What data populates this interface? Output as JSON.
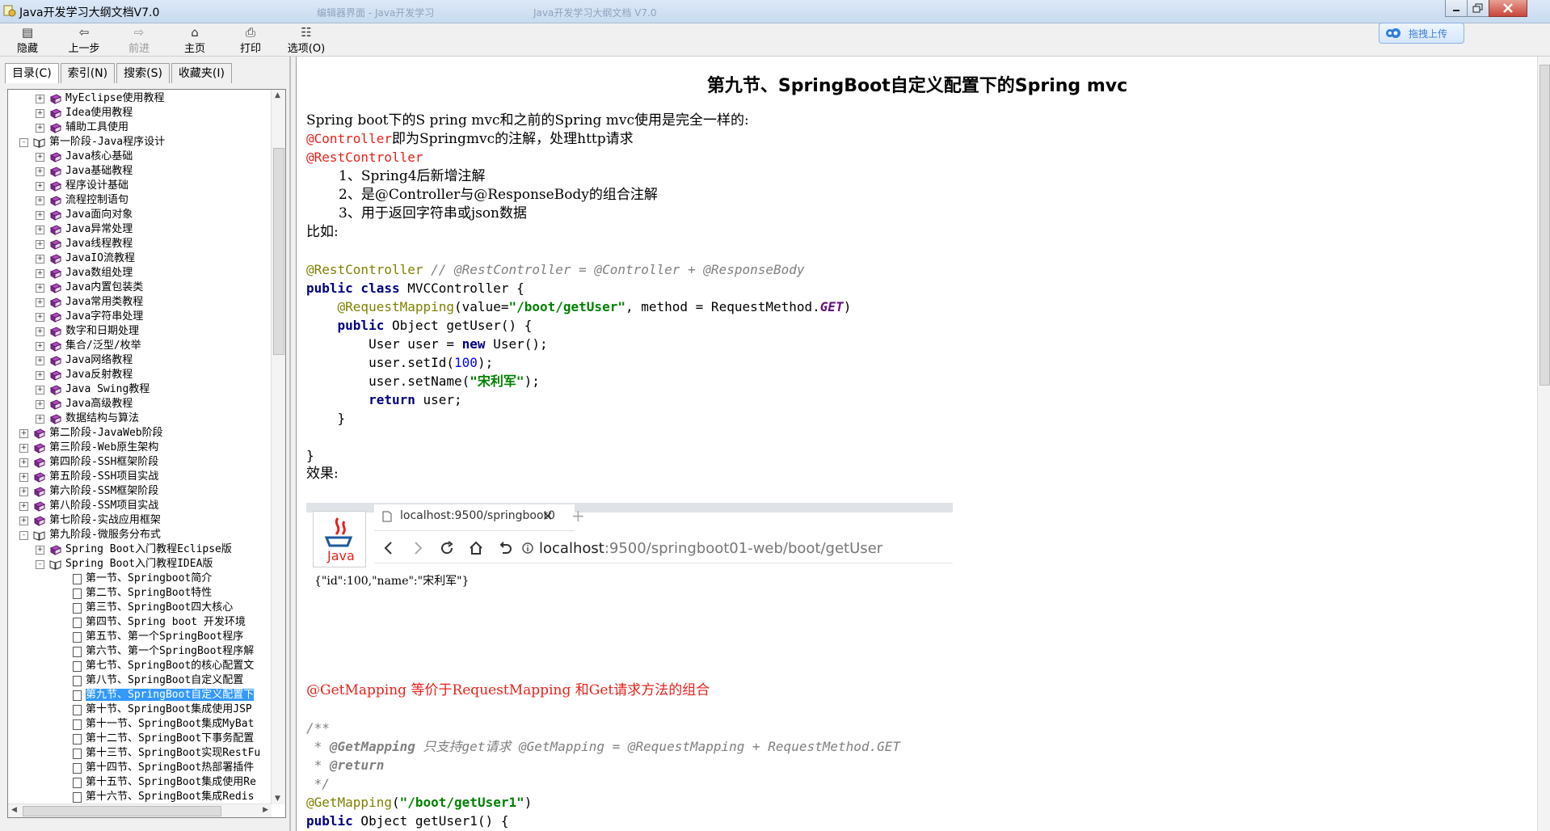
{
  "window": {
    "title": "Java开发学习大纲文档V7.0",
    "ghost_tabs": [
      "编辑器界面 - Java开发学习",
      "Java开发学习大纲文档 V7.0"
    ]
  },
  "toolbar": [
    {
      "label": "隐藏",
      "icon": "hide-icon",
      "enabled": true
    },
    {
      "label": "上一步",
      "icon": "back-icon",
      "enabled": true
    },
    {
      "label": "前进",
      "icon": "forward-icon",
      "enabled": false
    },
    {
      "label": "主页",
      "icon": "home-icon",
      "enabled": true
    },
    {
      "label": "打印",
      "icon": "print-icon",
      "enabled": true
    },
    {
      "label": "选项(O)",
      "icon": "options-icon",
      "enabled": true
    }
  ],
  "upload_button": "拖拽上传",
  "nav_tabs": [
    "目录(C)",
    "索引(N)",
    "搜索(S)",
    "收藏夹(I)"
  ],
  "tree": [
    {
      "label": "MyEclipse使用教程",
      "level": 1,
      "type": "book",
      "expander": "+"
    },
    {
      "label": "Idea使用教程",
      "level": 1,
      "type": "book",
      "expander": "+"
    },
    {
      "label": "辅助工具使用",
      "level": 1,
      "type": "book",
      "expander": "+"
    },
    {
      "label": "第一阶段-Java程序设计",
      "level": 0,
      "type": "openbook",
      "expander": "-"
    },
    {
      "label": "Java核心基础",
      "level": 1,
      "type": "book",
      "expander": "+"
    },
    {
      "label": "Java基础教程",
      "level": 1,
      "type": "book",
      "expander": "+"
    },
    {
      "label": "程序设计基础",
      "level": 1,
      "type": "book",
      "expander": "+"
    },
    {
      "label": "流程控制语句",
      "level": 1,
      "type": "book",
      "expander": "+"
    },
    {
      "label": "Java面向对象",
      "level": 1,
      "type": "book",
      "expander": "+"
    },
    {
      "label": "Java异常处理",
      "level": 1,
      "type": "book",
      "expander": "+"
    },
    {
      "label": "Java线程教程",
      "level": 1,
      "type": "book",
      "expander": "+"
    },
    {
      "label": "JavaIO流教程",
      "level": 1,
      "type": "book",
      "expander": "+"
    },
    {
      "label": "Java数组处理",
      "level": 1,
      "type": "book",
      "expander": "+"
    },
    {
      "label": "Java内置包装类",
      "level": 1,
      "type": "book",
      "expander": "+"
    },
    {
      "label": "Java常用类教程",
      "level": 1,
      "type": "book",
      "expander": "+"
    },
    {
      "label": "Java字符串处理",
      "level": 1,
      "type": "book",
      "expander": "+"
    },
    {
      "label": "数字和日期处理",
      "level": 1,
      "type": "book",
      "expander": "+"
    },
    {
      "label": "集合/泛型/枚举",
      "level": 1,
      "type": "book",
      "expander": "+"
    },
    {
      "label": "Java网络教程",
      "level": 1,
      "type": "book",
      "expander": "+"
    },
    {
      "label": "Java反射教程",
      "level": 1,
      "type": "book",
      "expander": "+"
    },
    {
      "label": "Java Swing教程",
      "level": 1,
      "type": "book",
      "expander": "+"
    },
    {
      "label": "Java高级教程",
      "level": 1,
      "type": "book",
      "expander": "+"
    },
    {
      "label": "数据结构与算法",
      "level": 1,
      "type": "book",
      "expander": "+"
    },
    {
      "label": "第二阶段-JavaWeb阶段",
      "level": 0,
      "type": "book",
      "expander": "+"
    },
    {
      "label": "第三阶段-Web原生架构",
      "level": 0,
      "type": "book",
      "expander": "+"
    },
    {
      "label": "第四阶段-SSH框架阶段",
      "level": 0,
      "type": "book",
      "expander": "+"
    },
    {
      "label": "第五阶段-SSH项目实战",
      "level": 0,
      "type": "book",
      "expander": "+"
    },
    {
      "label": "第六阶段-SSM框架阶段",
      "level": 0,
      "type": "book",
      "expander": "+"
    },
    {
      "label": "第八阶段-SSM项目实战",
      "level": 0,
      "type": "book",
      "expander": "+"
    },
    {
      "label": "第七阶段-实战应用框架",
      "level": 0,
      "type": "book",
      "expander": "+"
    },
    {
      "label": "第九阶段-微服务分布式",
      "level": 0,
      "type": "openbook",
      "expander": "-"
    },
    {
      "label": "Spring Boot入门教程Eclipse版",
      "level": 1,
      "type": "book",
      "expander": "+"
    },
    {
      "label": "Spring Boot入门教程IDEA版",
      "level": 1,
      "type": "openbook",
      "expander": "-"
    },
    {
      "label": "第一节、Springboot简介",
      "level": 2,
      "type": "page"
    },
    {
      "label": "第二节、SpringBoot特性",
      "level": 2,
      "type": "page"
    },
    {
      "label": "第三节、SpringBoot四大核心",
      "level": 2,
      "type": "page"
    },
    {
      "label": "第四节、Spring boot 开发环境",
      "level": 2,
      "type": "page"
    },
    {
      "label": "第五节、第一个SpringBoot程序",
      "level": 2,
      "type": "page"
    },
    {
      "label": "第六节、第一个SpringBoot程序解",
      "level": 2,
      "type": "page"
    },
    {
      "label": "第七节、SpringBoot的核心配置文",
      "level": 2,
      "type": "page"
    },
    {
      "label": "第八节、SpringBoot自定义配置",
      "level": 2,
      "type": "page"
    },
    {
      "label": "第九节、SpringBoot自定义配置下",
      "level": 2,
      "type": "page",
      "selected": true
    },
    {
      "label": "第十节、SpringBoot集成使用JSP",
      "level": 2,
      "type": "page"
    },
    {
      "label": "第十一节、SpringBoot集成MyBat",
      "level": 2,
      "type": "page"
    },
    {
      "label": "第十二节、SpringBoot下事务配置",
      "level": 2,
      "type": "page"
    },
    {
      "label": "第十三节、SpringBoot实现RestFu",
      "level": 2,
      "type": "page"
    },
    {
      "label": "第十四节、SpringBoot热部署插件",
      "level": 2,
      "type": "page"
    },
    {
      "label": "第十五节、SpringBoot集成使用Re",
      "level": 2,
      "type": "page"
    },
    {
      "label": "第十六节、SpringBoot集成Redis",
      "level": 2,
      "type": "page"
    }
  ],
  "content": {
    "title": "第九节、SpringBoot自定义配置下的Spring mvc",
    "intro": "Spring boot下的S pring mvc和之前的Spring mvc使用是完全一样的:",
    "controller_anno": "@Controller",
    "controller_desc": "即为Springmvc的注解，处理http请求",
    "restcontroller_anno": "@RestController",
    "points": [
      "1、Spring4后新增注解",
      "2、是@Controller与@ResponseBody的组合注解",
      "3、用于返回字符串或json数据"
    ],
    "example_label": "比如:",
    "result_label": "效果:",
    "browser": {
      "tab_title": "localhost:9500/springboot0",
      "url_host": "localhost",
      "url_rest": ":9500/springboot01-web/boot/getUser",
      "java_text": "Java",
      "result": "{\"id\":100,\"name\":\"宋利军\"}"
    },
    "getmapping_note": "@GetMapping 等价于RequestMapping 和Get请求方法的组合"
  }
}
